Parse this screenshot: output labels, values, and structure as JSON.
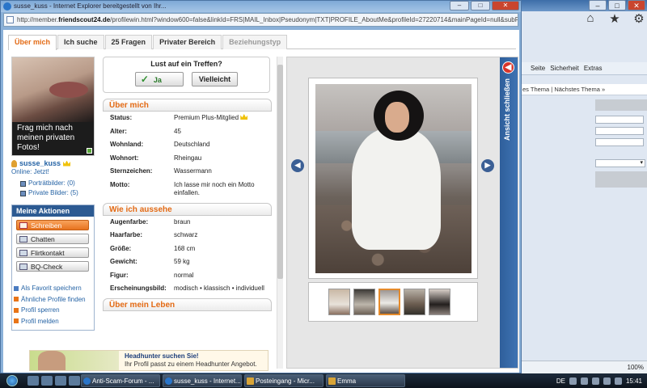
{
  "bg_window": {
    "toolbar_icons": [
      "home-icon",
      "star-icon",
      "gear-icon"
    ],
    "menu": [
      "Seite",
      "Sicherheit",
      "Extras"
    ],
    "nav_text": "es Thema | Nächstes Thema »",
    "zoom": "100%"
  },
  "popup": {
    "title": "susse_kuss - Internet Explorer bereitgestellt von Ihr...",
    "url_prefix": "http://member.",
    "url_domain": "friendscout24.de",
    "url_rest": "/profilewin.html?window600=false&linkId=FRS|MAIL_Inbox|Pseudonym|TXT|PROFILE_AboutMe&profileId=27220714&mainPageId=null&subPageId=null&"
  },
  "tabs": [
    {
      "label": "Über mich",
      "state": "active"
    },
    {
      "label": "Ich suche",
      "state": "normal"
    },
    {
      "label": "25 Fragen",
      "state": "normal"
    },
    {
      "label": "Privater Bereich",
      "state": "normal"
    },
    {
      "label": "Beziehungstyp",
      "state": "disabled"
    }
  ],
  "profile": {
    "photo_text": "Frag mich nach meinen privaten Fotos!",
    "username": "susse_kuss",
    "online": "Online: Jetzt!",
    "portrait": "Porträtbilder: (0)",
    "private": "Private Bilder: (5)"
  },
  "actions": {
    "header": "Meine Aktionen",
    "buttons": [
      "Schreiben",
      "Chatten",
      "Flirtkontakt",
      "BQ-Check"
    ],
    "links": [
      "Als Favorit speichern",
      "Ähnliche Profile finden",
      "Profil sperren",
      "Profil melden"
    ]
  },
  "meet": {
    "question": "Lust auf ein Treffen?",
    "yes": "Ja",
    "maybe": "Vielleicht"
  },
  "about": {
    "title": "Über mich",
    "rows": [
      {
        "k": "Status:",
        "v": "Premium Plus-Mitglied"
      },
      {
        "k": "Alter:",
        "v": "45"
      },
      {
        "k": "Wohnland:",
        "v": "Deutschland"
      },
      {
        "k": "Wohnort:",
        "v": "Rheingau"
      },
      {
        "k": "Sternzeichen:",
        "v": "Wassermann"
      },
      {
        "k": "Motto:",
        "v": "Ich lasse mir noch ein Motto einfallen."
      }
    ]
  },
  "looks": {
    "title": "Wie ich aussehe",
    "rows": [
      {
        "k": "Augenfarbe:",
        "v": "braun"
      },
      {
        "k": "Haarfarbe:",
        "v": "schwarz"
      },
      {
        "k": "Größe:",
        "v": "168 cm"
      },
      {
        "k": "Gewicht:",
        "v": "59 kg"
      },
      {
        "k": "Figur:",
        "v": "normal"
      },
      {
        "k": "Erscheinungsbild:",
        "v": "modisch • klassisch • individuell"
      }
    ]
  },
  "life": {
    "title": "Über mein Leben"
  },
  "gallery": {
    "close_label": "Ansicht schließen",
    "thumbnail_count": 5,
    "selected_thumbnail": 3
  },
  "banner": {
    "headline": "Headhunter suchen Sie!",
    "text": "Ihr Profil passt zu einem Headhunter Angebot."
  },
  "taskbar": {
    "tasks": [
      "Anti-Scam-Forum - ...",
      "susse_kuss - Internet...",
      "Posteingang - Micr...",
      "Emma"
    ],
    "lang": "DE",
    "time": "15:41"
  },
  "colors": {
    "accent": "#e36a14",
    "link": "#2563a5",
    "header_blue": "#2c5a92"
  }
}
